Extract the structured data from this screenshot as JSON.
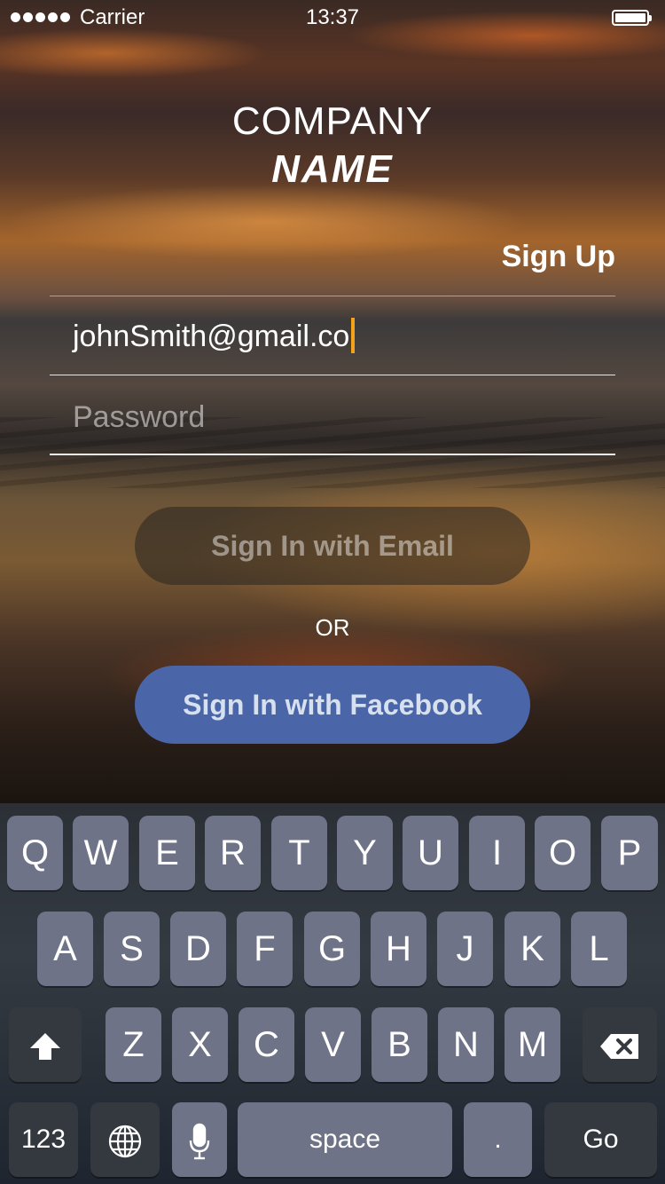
{
  "status": {
    "carrier": "Carrier",
    "time": "13:37"
  },
  "brand": {
    "line1": "COMPANY",
    "line2": "NAME"
  },
  "header": {
    "signup_label": "Sign Up"
  },
  "form": {
    "email_value": "johnSmith@gmail.co",
    "password_placeholder": "Password",
    "email_button": "Sign In with Email",
    "or_label": "OR",
    "facebook_button": "Sign In with Facebook"
  },
  "colors": {
    "facebook": "#4a66a8",
    "cursor": "#f4a21a",
    "key": "#6f7387"
  },
  "keyboard": {
    "row1": [
      "Q",
      "W",
      "E",
      "R",
      "T",
      "Y",
      "U",
      "I",
      "O",
      "P"
    ],
    "row2": [
      "A",
      "S",
      "D",
      "F",
      "G",
      "H",
      "J",
      "K",
      "L"
    ],
    "row3": [
      "Z",
      "X",
      "C",
      "V",
      "B",
      "N",
      "M"
    ],
    "numbers": "123",
    "space": "space",
    "period": ".",
    "go": "Go",
    "icons": [
      "shift-icon",
      "delete-icon",
      "globe-icon",
      "microphone-icon"
    ]
  }
}
